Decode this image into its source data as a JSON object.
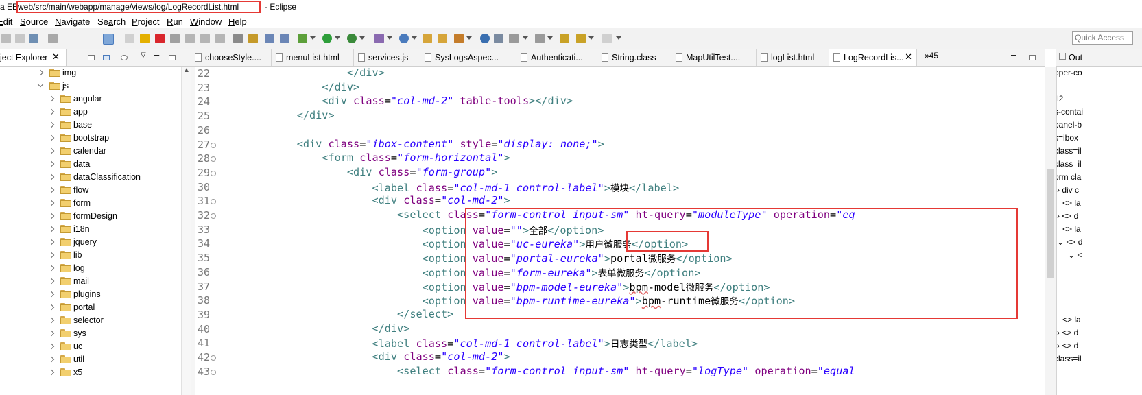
{
  "title_bar": {
    "perspective": "a EE",
    "file_path": "web/src/main/webapp/manage/views/log/LogRecordList.html",
    "app_suffix": "- Eclipse"
  },
  "menu": [
    {
      "label": "Edit",
      "mnemonic": "E",
      "rest": "dit"
    },
    {
      "label": "Source",
      "mnemonic": "S",
      "rest": "ource"
    },
    {
      "label": "Navigate",
      "mnemonic": "N",
      "rest": "avigate"
    },
    {
      "label": "Search",
      "mnemonic": "a",
      "pre": "Se",
      "rest": "rch"
    },
    {
      "label": "Project",
      "mnemonic": "P",
      "rest": "roject"
    },
    {
      "label": "Run",
      "mnemonic": "R",
      "rest": "un"
    },
    {
      "label": "Window",
      "mnemonic": "W",
      "rest": "indow"
    },
    {
      "label": "Help",
      "mnemonic": "H",
      "rest": "elp"
    }
  ],
  "toolbar": {
    "quick_access_placeholder": "Quick Access"
  },
  "project_explorer": {
    "title": "ject Explorer",
    "items": [
      {
        "label": "img",
        "open": false,
        "level": 1
      },
      {
        "label": "js",
        "open": true,
        "level": 1
      },
      {
        "label": "angular",
        "open": false,
        "level": 2
      },
      {
        "label": "app",
        "open": false,
        "level": 2
      },
      {
        "label": "base",
        "open": false,
        "level": 2
      },
      {
        "label": "bootstrap",
        "open": false,
        "level": 2
      },
      {
        "label": "calendar",
        "open": false,
        "level": 2
      },
      {
        "label": "data",
        "open": false,
        "level": 2
      },
      {
        "label": "dataClassification",
        "open": false,
        "level": 2
      },
      {
        "label": "flow",
        "open": false,
        "level": 2
      },
      {
        "label": "form",
        "open": false,
        "level": 2
      },
      {
        "label": "formDesign",
        "open": false,
        "level": 2
      },
      {
        "label": "i18n",
        "open": false,
        "level": 2
      },
      {
        "label": "jquery",
        "open": false,
        "level": 2
      },
      {
        "label": "lib",
        "open": false,
        "level": 2
      },
      {
        "label": "log",
        "open": false,
        "level": 2
      },
      {
        "label": "mail",
        "open": false,
        "level": 2
      },
      {
        "label": "plugins",
        "open": false,
        "level": 2
      },
      {
        "label": "portal",
        "open": false,
        "level": 2
      },
      {
        "label": "selector",
        "open": false,
        "level": 2
      },
      {
        "label": "sys",
        "open": false,
        "level": 2
      },
      {
        "label": "uc",
        "open": false,
        "level": 2
      },
      {
        "label": "util",
        "open": false,
        "level": 2
      },
      {
        "label": "x5",
        "open": false,
        "level": 2
      }
    ]
  },
  "editor_tabs": [
    {
      "label": "chooseStyle....",
      "active": false
    },
    {
      "label": "menuList.html",
      "active": false
    },
    {
      "label": "services.js",
      "active": false
    },
    {
      "label": "SysLogsAspec...",
      "active": false
    },
    {
      "label": "Authenticati...",
      "active": false
    },
    {
      "label": "String.class",
      "active": false
    },
    {
      "label": "MapUtilTest....",
      "active": false
    },
    {
      "label": "logList.html",
      "active": false
    },
    {
      "label": "LogRecordLis...",
      "active": true
    }
  ],
  "overflow_tabs": "»45",
  "code_lines": [
    {
      "num": "22",
      "fold": false,
      "html": "                    <span class='kw'>&lt;/div&gt;</span>"
    },
    {
      "num": "23",
      "fold": false,
      "html": "                <span class='kw'>&lt;/div&gt;</span>"
    },
    {
      "num": "24",
      "fold": false,
      "html": "                <span class='kw'>&lt;div</span> <span class='at'>class</span>=<span class='val'>\"col-md-2\"</span> <span class='at'>table-tools</span><span class='kw'>&gt;&lt;/div&gt;</span>"
    },
    {
      "num": "25",
      "fold": false,
      "html": "            <span class='kw'>&lt;/div&gt;</span>"
    },
    {
      "num": "26",
      "fold": false,
      "html": ""
    },
    {
      "num": "27",
      "fold": true,
      "html": "            <span class='kw'>&lt;div</span> <span class='at'>class</span>=<span class='val'>\"ibox-content\"</span> <span class='at'>style</span>=<span class='val'>\"display: <i>none</i>;\"</span><span class='kw'>&gt;</span>"
    },
    {
      "num": "28",
      "fold": true,
      "html": "                <span class='kw'>&lt;form</span> <span class='at'>class</span>=<span class='val'>\"form-horizontal\"</span><span class='kw'>&gt;</span>"
    },
    {
      "num": "29",
      "fold": true,
      "html": "                    <span class='kw'>&lt;div</span> <span class='at'>class</span>=<span class='val'>\"form-group\"</span><span class='kw'>&gt;</span>"
    },
    {
      "num": "30",
      "fold": false,
      "html": "                        <span class='kw'>&lt;label</span> <span class='at'>class</span>=<span class='val'>\"col-md-1 control-label\"</span><span class='kw'>&gt;</span><span class='cn'>模块</span><span class='kw'>&lt;/label&gt;</span>"
    },
    {
      "num": "31",
      "fold": true,
      "html": "                        <span class='kw'>&lt;div</span> <span class='at'>class</span>=<span class='val'>\"col-md-2\"</span><span class='kw'>&gt;</span>"
    },
    {
      "num": "32",
      "fold": true,
      "html": "                            <span class='kw'>&lt;select</span> <span class='at'>class</span>=<span class='val'>\"form-control input-sm\"</span> <span class='at'>ht-query</span>=<span class='val'>\"moduleType\"</span> <span class='at'>operation</span>=<span class='val'>\"eq</span>"
    },
    {
      "num": "33",
      "fold": false,
      "html": "                                <span class='kw'>&lt;option</span> <span class='at'>value</span>=<span class='val'>\"\"</span><span class='kw'>&gt;</span><span class='cn'>全部</span><span class='kw'>&lt;/option&gt;</span>"
    },
    {
      "num": "34",
      "fold": false,
      "html": "                                <span class='kw'>&lt;option</span> <span class='at'>value</span>=<span class='val'>\"uc-eureka\"</span><span class='kw'>&gt;</span><span class='cn'>用户微服务</span><span class='kw'>&lt;/option&gt;</span>"
    },
    {
      "num": "35",
      "fold": false,
      "html": "                                <span class='kw'>&lt;option</span> <span class='at'>value</span>=<span class='val'>\"portal-eureka\"</span><span class='kw'>&gt;</span>portal<span class='cn'>微服务</span><span class='kw'>&lt;/option&gt;</span>"
    },
    {
      "num": "36",
      "fold": false,
      "html": "                                <span class='kw'>&lt;option</span> <span class='at'>value</span>=<span class='val'>\"form-eureka\"</span><span class='kw'>&gt;</span><span class='cn'>表单微服务</span><span class='kw'>&lt;/option&gt;</span>"
    },
    {
      "num": "37",
      "fold": false,
      "html": "                                <span class='kw'>&lt;option</span> <span class='at'>value</span>=<span class='val'>\"bpm-model-eureka\"</span><span class='kw'>&gt;</span><span class='sq'>bpm</span>-model<span class='cn'>微服务</span><span class='kw'>&lt;/option&gt;</span>"
    },
    {
      "num": "38",
      "fold": false,
      "html": "                                <span class='kw'>&lt;option</span> <span class='at'>value</span>=<span class='val'>\"bpm-runtime-eureka\"</span><span class='kw'>&gt;</span><span class='sq'>bpm</span>-runtime<span class='cn'>微服务</span><span class='kw'>&lt;/option&gt;</span>"
    },
    {
      "num": "39",
      "fold": false,
      "html": "                            <span class='kw'>&lt;/select&gt;</span>"
    },
    {
      "num": "40",
      "fold": false,
      "html": "                        <span class='kw'>&lt;/div&gt;</span>"
    },
    {
      "num": "41",
      "fold": false,
      "html": "                        <span class='kw'>&lt;label</span> <span class='at'>class</span>=<span class='val'>\"col-md-1 control-label\"</span><span class='kw'>&gt;</span><span class='cn'>日志类型</span><span class='kw'>&lt;/label&gt;</span>"
    },
    {
      "num": "42",
      "fold": true,
      "html": "                        <span class='kw'>&lt;div</span> <span class='at'>class</span>=<span class='val'>\"col-md-2\"</span><span class='kw'>&gt;</span>"
    },
    {
      "num": "43",
      "fold": true,
      "html": "                            <span class='kw'>&lt;select</span> <span class='at'>class</span>=<span class='val'>\"form-control input-sm\"</span> <span class='at'>ht-query</span>=<span class='val'>\"logType\"</span> <span class='at'>operation</span>=<span class='val'>\"equal</span>"
    }
  ],
  "outline": {
    "title": "Out",
    "rows": [
      {
        "text": "pper-co"
      },
      {
        "text": ""
      },
      {
        "text": "12"
      },
      {
        "text": "s-contai"
      },
      {
        "text": "panel-b"
      },
      {
        "text": "s=ibox"
      },
      {
        "text": "class=il"
      },
      {
        "text": "class=il"
      },
      {
        "text": "orm cla"
      },
      {
        "text": "› div c"
      },
      {
        "text": "<> la"
      },
      {
        "text": "› <> d"
      },
      {
        "text": "<> la"
      },
      {
        "text": "⌄ <> d"
      },
      {
        "text": "⌄ <"
      },
      {
        "text": ""
      },
      {
        "text": ""
      },
      {
        "text": ""
      },
      {
        "text": ""
      },
      {
        "text": ""
      },
      {
        "text": ""
      },
      {
        "text": ""
      },
      {
        "text": ""
      },
      {
        "text": "<> la"
      },
      {
        "text": "› <> d"
      },
      {
        "text": "› <> d"
      },
      {
        "text": "class=il"
      }
    ]
  },
  "colors": {
    "highlight_box": "#e53935",
    "tag": "#3f7f7f",
    "attribute": "#7f007f",
    "value": "#2a00ff"
  }
}
